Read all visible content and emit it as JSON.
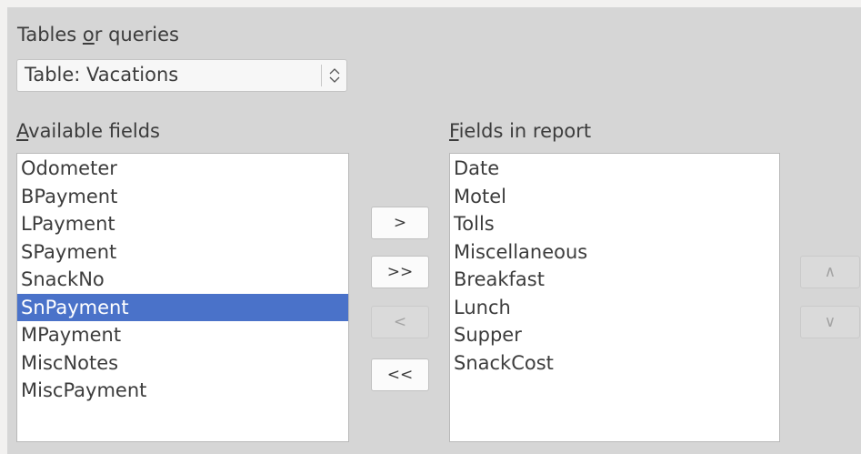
{
  "tables_or_queries": {
    "label_pre": "Tables ",
    "label_accel": "o",
    "label_post": "r queries",
    "selected": "Table: Vacations"
  },
  "available_fields": {
    "label_accel": "A",
    "label_post": "vailable fields",
    "items": [
      "Odometer",
      "BPayment",
      "LPayment",
      "SPayment",
      "SnackNo",
      "SnPayment",
      "MPayment",
      "MiscNotes",
      "MiscPayment"
    ],
    "selected_index": 5
  },
  "fields_in_report": {
    "label_accel": "F",
    "label_post": "ields in report",
    "items": [
      "Date",
      "Motel",
      "Tolls",
      "Miscellaneous",
      "Breakfast",
      "Lunch",
      "Supper",
      "SnackCost"
    ]
  },
  "buttons": {
    "add_one": ">",
    "add_all": ">>",
    "remove_one": "<",
    "remove_all": "<<",
    "move_up": "∧",
    "move_down": "∨"
  },
  "icons": {
    "combo": "up-down-chevron-icon"
  },
  "colors": {
    "selection": "#4a72c9",
    "panel": "#d6d6d6"
  }
}
